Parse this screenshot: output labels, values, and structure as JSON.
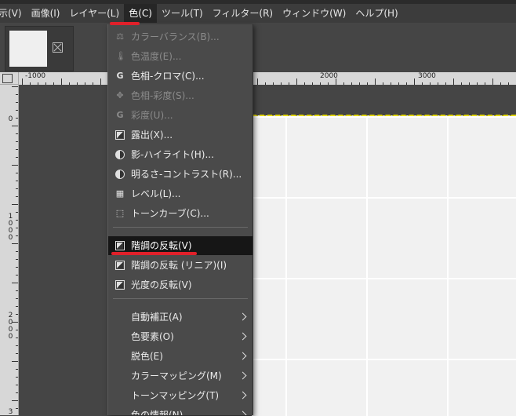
{
  "menubar": {
    "items": [
      {
        "label": "示(V)"
      },
      {
        "label": "画像(I)"
      },
      {
        "label": "レイヤー(L)"
      },
      {
        "label": "色(C)"
      },
      {
        "label": "ツール(T)"
      },
      {
        "label": "フィルター(R)"
      },
      {
        "label": "ウィンドウ(W)"
      },
      {
        "label": "ヘルプ(H)"
      }
    ],
    "active_index": 3
  },
  "ruler": {
    "h_labels": [
      "-1000",
      "2000",
      "3000"
    ],
    "v_labels": [
      "0",
      "1000",
      "2000",
      "3"
    ]
  },
  "color_menu": {
    "items": [
      {
        "label": "カラーバランス(B)...",
        "icon": "color-balance-icon",
        "disabled": true
      },
      {
        "label": "色温度(E)...",
        "icon": "color-temperature-icon",
        "disabled": true
      },
      {
        "label": "色相-クロマ(C)...",
        "icon": "hue-chroma-icon",
        "disabled": false
      },
      {
        "label": "色相-彩度(S)...",
        "icon": "hue-saturation-icon",
        "disabled": true
      },
      {
        "label": "彩度(U)...",
        "icon": "saturation-icon",
        "disabled": true
      },
      {
        "label": "露出(X)...",
        "icon": "exposure-icon",
        "disabled": false
      },
      {
        "label": "影-ハイライト(H)...",
        "icon": "shadows-highlights-icon",
        "disabled": false
      },
      {
        "label": "明るさ-コントラスト(R)...",
        "icon": "brightness-contrast-icon",
        "disabled": false
      },
      {
        "label": "レベル(L)...",
        "icon": "levels-icon",
        "disabled": false
      },
      {
        "label": "トーンカーブ(C)...",
        "icon": "curves-icon",
        "disabled": false
      },
      {
        "label": "階調の反転(V)",
        "icon": "invert-icon",
        "disabled": false,
        "highlighted": true
      },
      {
        "label": "階調の反転 (リニア)(I)",
        "icon": "linear-invert-icon",
        "disabled": false
      },
      {
        "label": "光度の反転(V)",
        "icon": "value-invert-icon",
        "disabled": false
      },
      {
        "label": "自動補正(A)",
        "submenu": true
      },
      {
        "label": "色要素(O)",
        "submenu": true
      },
      {
        "label": "脱色(E)",
        "submenu": true
      },
      {
        "label": "カラーマッピング(M)",
        "submenu": true
      },
      {
        "label": "トーンマッピング(T)",
        "submenu": true
      },
      {
        "label": "色の情報(N)",
        "submenu": true
      }
    ]
  },
  "colors": {
    "menubar_bg": "#3c3c3c",
    "menu_bg": "#4a4a4a",
    "highlight_bg": "#161616",
    "annotation_red": "#e0202a"
  }
}
